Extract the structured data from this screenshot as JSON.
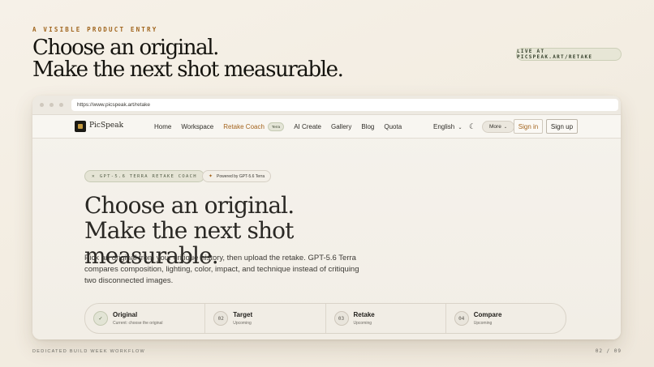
{
  "slide": {
    "kicker": "A VISIBLE PRODUCT ENTRY",
    "headline_line1": "Choose an original.",
    "headline_line2": "Make the next shot measurable.",
    "live_label": "LIVE AT PICSPEAK.ART/RETAKE",
    "footer_left": "DEDICATED BUILD WEEK WORKFLOW",
    "footer_right": "02 / 09"
  },
  "browser": {
    "url": "https://www.picspeak.art/retake"
  },
  "site": {
    "brand": "PicSpeak",
    "nav": [
      "Home",
      "Workspace",
      "Retake Coach",
      "AI Create",
      "Gallery",
      "Blog",
      "Quota"
    ],
    "nav_badge": "Terra",
    "language": "English",
    "more": "More",
    "sign_in": "Sign in",
    "sign_up": "Sign up",
    "chip_model": "GPT-5.6 TERRA RETAKE COACH",
    "chip_powered": "Powered by GPT-5.6 Terra",
    "hero_title": "Choose an original. Make the next shot measurable.",
    "hero_body": "Pick an original from your critique history, then upload the retake. GPT-5.6 Terra compares composition, lighting, color, impact, and technique instead of critiquing two disconnected images.",
    "steps": [
      {
        "num": "✓",
        "title": "Original",
        "sub": "Current: choose the original"
      },
      {
        "num": "02",
        "title": "Target",
        "sub": "Upcoming"
      },
      {
        "num": "03",
        "title": "Retake",
        "sub": "Upcoming"
      },
      {
        "num": "04",
        "title": "Compare",
        "sub": "Upcoming"
      }
    ]
  },
  "colors": {
    "accent": "#a4651f",
    "sage": "#e5e4d5",
    "ink": "#15140f"
  }
}
